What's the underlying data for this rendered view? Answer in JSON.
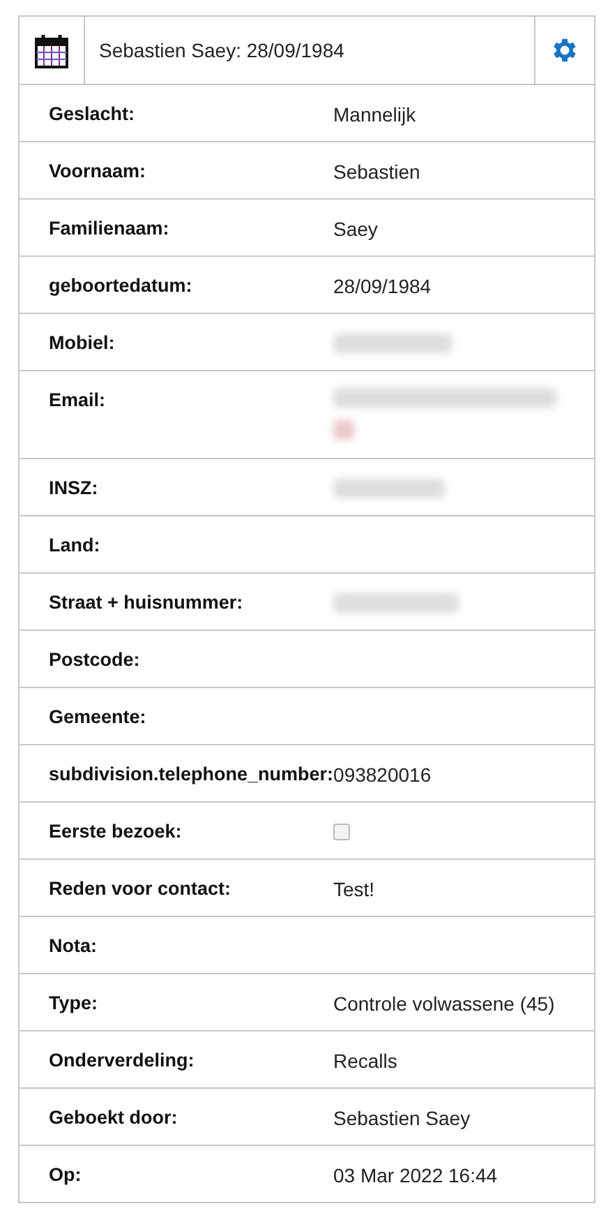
{
  "header": {
    "title": "Sebastien Saey: 28/09/1984"
  },
  "rows": [
    {
      "kind": "text",
      "label": "Geslacht:",
      "value": "Mannelijk"
    },
    {
      "kind": "text",
      "label": "Voornaam:",
      "value": "Sebastien"
    },
    {
      "kind": "text",
      "label": "Familienaam:",
      "value": "Saey"
    },
    {
      "kind": "text",
      "label": "geboortedatum:",
      "value": "28/09/1984"
    },
    {
      "kind": "blurred",
      "label": "Mobiel:"
    },
    {
      "kind": "blurred_long",
      "label": "Email:"
    },
    {
      "kind": "blurred",
      "label": "INSZ:"
    },
    {
      "kind": "text",
      "label": "Land:"
    },
    {
      "kind": "blurred",
      "label": "Straat + huisnummer:"
    },
    {
      "kind": "text",
      "label": "Postcode:"
    },
    {
      "kind": "text",
      "label": "Gemeente:"
    },
    {
      "kind": "text",
      "label": "subdivision.telephone_number:",
      "value": "093820016"
    },
    {
      "kind": "checkbox",
      "label": "Eerste bezoek:",
      "checked": false,
      "disabled": true
    },
    {
      "kind": "text",
      "label": "Reden voor contact:",
      "value": "Test!"
    },
    {
      "kind": "text",
      "label": "Nota:"
    },
    {
      "kind": "text",
      "label": "Type:",
      "value": "Controle volwassene (45)"
    },
    {
      "kind": "text",
      "label": "Onderverdeling:",
      "value": "Recalls"
    },
    {
      "kind": "text",
      "label": "Geboekt door:",
      "value": "Sebastien Saey"
    },
    {
      "kind": "text",
      "label": "Op:",
      "value": "03 Mar 2022 16:44"
    }
  ]
}
